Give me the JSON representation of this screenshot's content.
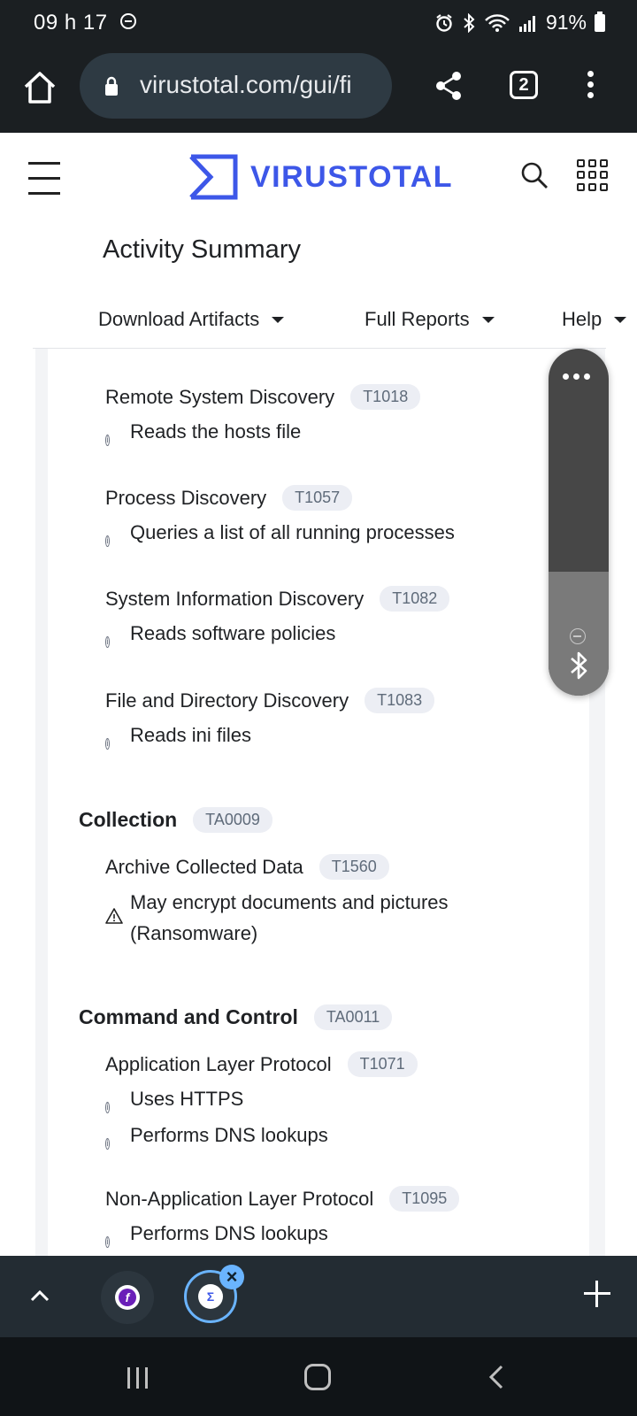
{
  "status_bar": {
    "time": "09 h 17",
    "battery": "91%"
  },
  "browser": {
    "url": "virustotal.com/gui/fi",
    "tab_count": "2"
  },
  "site": {
    "logo_text": "VIRUSTOTAL",
    "page_title": "Activity Summary"
  },
  "nav": {
    "download": "Download Artifacts",
    "reports": "Full Reports",
    "help": "Help"
  },
  "discovery": [
    {
      "name": "Remote System Discovery",
      "id": "T1018",
      "detail": "Reads the hosts file"
    },
    {
      "name": "Process Discovery",
      "id": "T1057",
      "detail": "Queries a list of all running processes"
    },
    {
      "name": "System Information Discovery",
      "id": "T1082",
      "detail": "Reads software policies"
    },
    {
      "name": "File and Directory Discovery",
      "id": "T1083",
      "detail": "Reads ini files"
    }
  ],
  "collection": {
    "name": "Collection",
    "id": "TA0009",
    "tech": {
      "name": "Archive Collected Data",
      "id": "T1560",
      "detail_line1": "May encrypt documents and pictures",
      "detail_line2": "(Ransomware)"
    }
  },
  "c2": {
    "name": "Command and Control",
    "id": "TA0011",
    "tech1": {
      "name": "Application Layer Protocol",
      "id": "T1071",
      "detail1": "Uses HTTPS",
      "detail2": "Performs DNS lookups"
    },
    "tech2": {
      "name": "Non-Application Layer Protocol",
      "id": "T1095",
      "detail1": "Performs DNS lookups"
    }
  },
  "colors": {
    "brand": "#3d57e8",
    "badge_bg": "#eceef4",
    "chrome": "#1b1f22"
  },
  "icons": [
    "home-icon",
    "lock-icon",
    "share-icon",
    "more-vert-icon",
    "hamburger-icon",
    "search-icon",
    "apps-grid-icon",
    "info-icon",
    "warning-icon",
    "bluetooth-icon",
    "chevron-up-icon",
    "plus-icon"
  ]
}
